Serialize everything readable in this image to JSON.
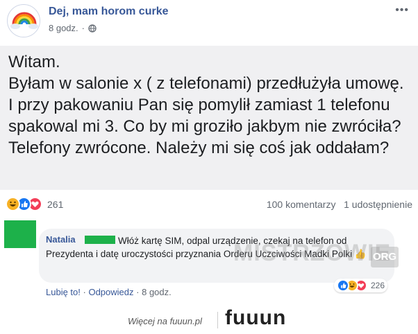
{
  "post": {
    "page_name": "Dej, mam horom curke",
    "time": "8 godz.",
    "more": "•••",
    "text": "Witam.\nByłam w salonie x ( z telefonami)  przedłużyła umowę. I przy pakowaniu Pan się pomylił zamiast 1 telefonu spakowal mi 3. Co by mi groziło jakbym nie zwróciła? Telefony zwrócone. Należy mi się coś jak oddałam?",
    "reaction_count": "261",
    "comments_label": "100 komentarzy",
    "shares_label": "1 udostępnienie",
    "reaction_icons": [
      "haha-icon",
      "like-icon",
      "love-icon"
    ]
  },
  "comment": {
    "author": "Natalia",
    "text": "Włóż kartę SIM, odpal urządzenie, czekaj na telefon od Prezydenta i datę uroczystości przyznania Orderu Uczciwości Madki Polki 👍",
    "reaction_count": "226",
    "like_label": "Lubię to!",
    "reply_label": "Odpowiedz",
    "time": "8 godz.",
    "separator": "·"
  },
  "watermark": {
    "text": "MISTRZOWIE",
    "suffix": "ORG"
  },
  "footer": {
    "text": "Więcej na fuuun.pl",
    "logo": "fuuun"
  },
  "colors": {
    "link": "#385898",
    "redaction": "#1db14a",
    "like": "#1877f2",
    "love": "#f33e58",
    "haha": "#f7b125"
  }
}
